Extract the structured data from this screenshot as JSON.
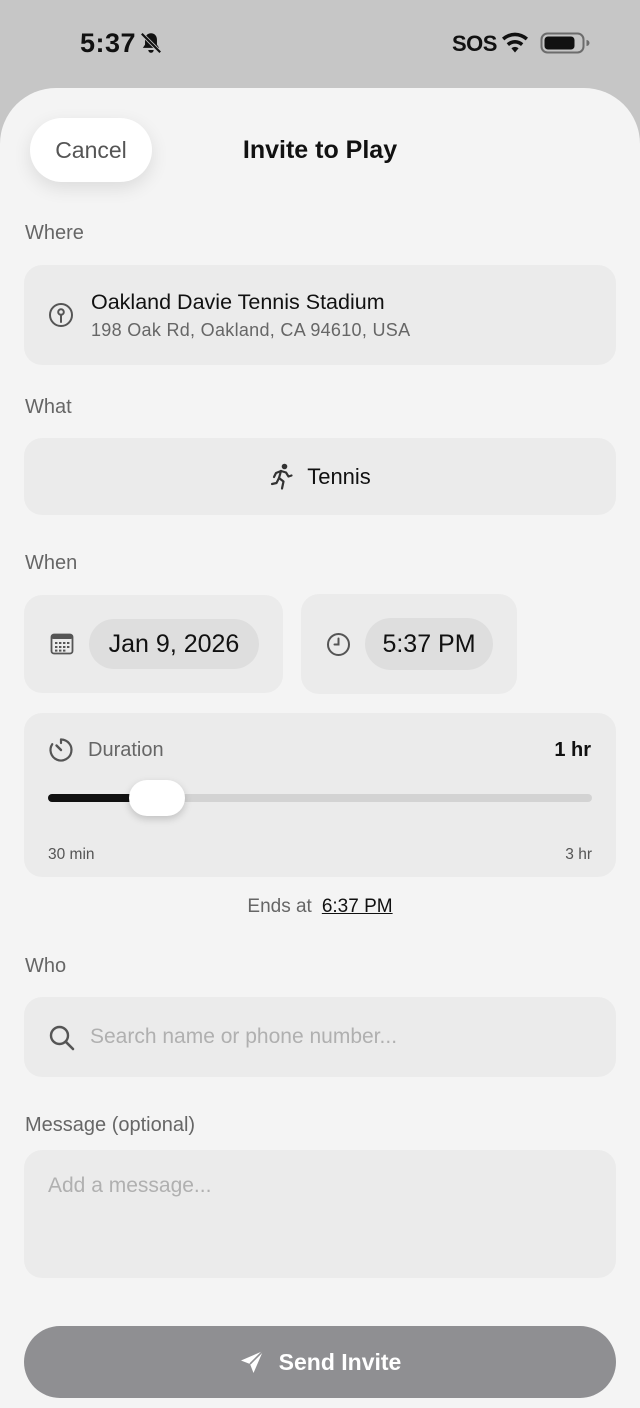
{
  "status_bar": {
    "time": "5:37",
    "carrier": "SOS",
    "icons": [
      "bell-slash-icon",
      "wifi-icon",
      "battery-icon"
    ]
  },
  "header": {
    "cancel_label": "Cancel",
    "title": "Invite to Play"
  },
  "where": {
    "label": "Where",
    "venue_name": "Oakland Davie Tennis Stadium",
    "venue_address": "198 Oak Rd, Oakland, CA 94610, USA",
    "icon": "location-pin-icon"
  },
  "what": {
    "label": "What",
    "sport": "Tennis",
    "icon": "running-person-icon"
  },
  "when": {
    "label": "When",
    "date": "Jan 9, 2026",
    "time": "5:37 PM"
  },
  "duration": {
    "label": "Duration",
    "value_label": "1 hr",
    "min_label": "30 min",
    "max_label": "3 hr",
    "min_minutes": 30,
    "max_minutes": 180,
    "value_minutes": 60,
    "ends_prefix": "Ends at",
    "ends_time": "6:37 PM"
  },
  "who": {
    "label": "Who",
    "placeholder": "Search name or phone number...",
    "value": ""
  },
  "message": {
    "label": "Message (optional)",
    "placeholder": "Add a message...",
    "value": ""
  },
  "send": {
    "label": "Send Invite"
  },
  "colors": {
    "sheet_background": "#f4f4f4",
    "card_background": "#ebebeb",
    "send_button_disabled": "#8f8f92",
    "slider_fill": "#111111"
  }
}
